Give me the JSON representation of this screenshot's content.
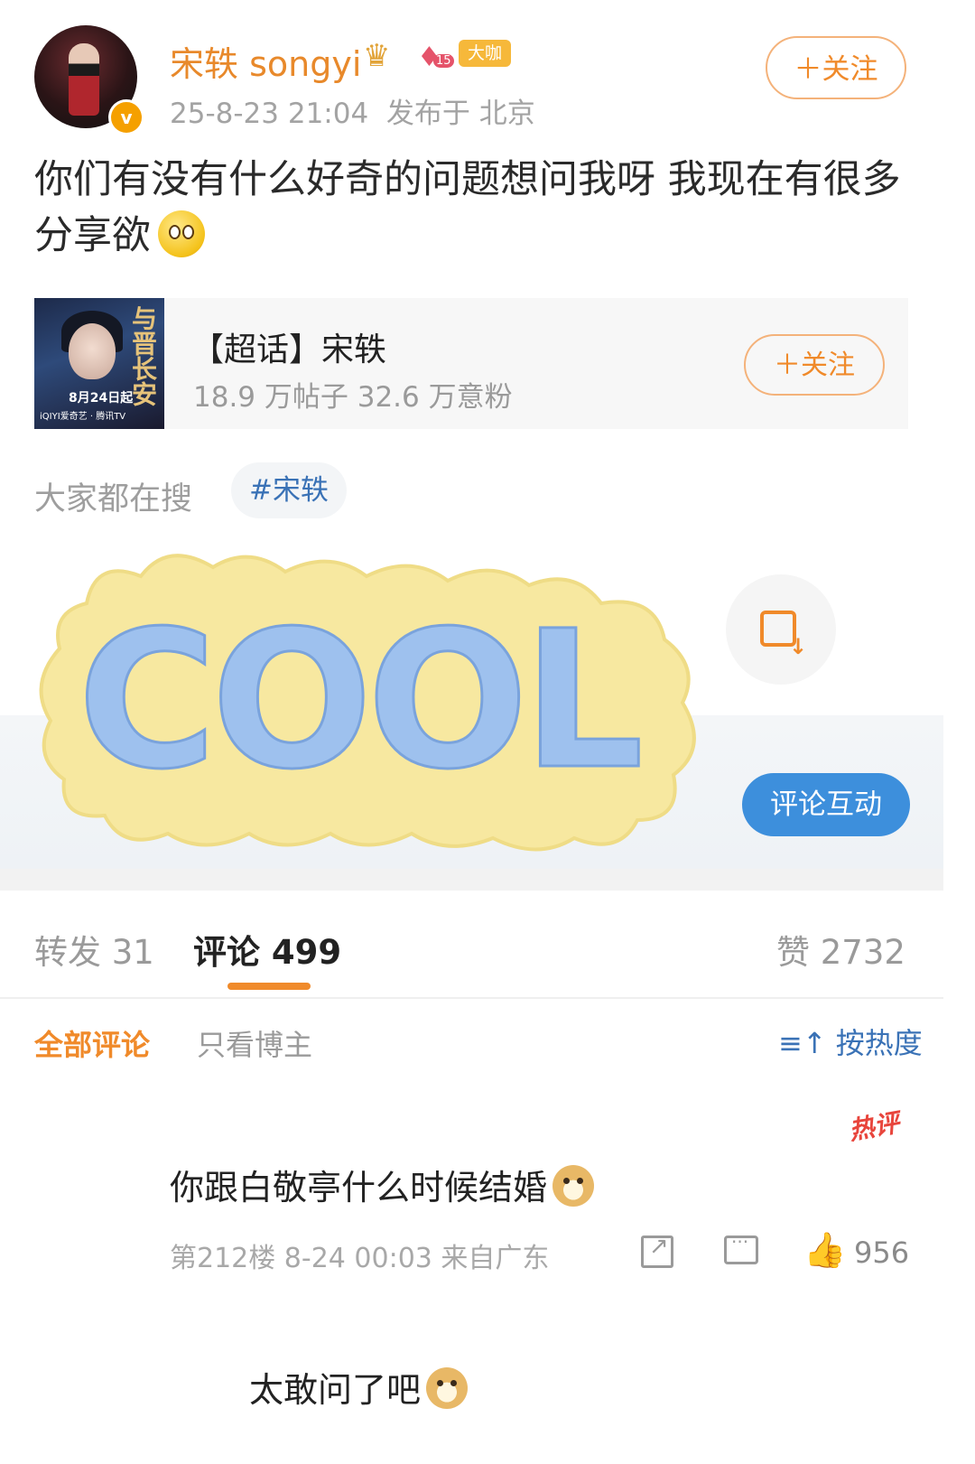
{
  "post": {
    "username": "宋轶 songyi",
    "badges": {
      "level": "15",
      "tag": "大咖"
    },
    "time": "25-8-23 21:04",
    "location": "发布于 北京",
    "follow_label": "＋关注",
    "text": "你们有没有什么好奇的问题想问我呀 我现在有很多分享欲",
    "emoji_icon": "thinking-emoji"
  },
  "topic_card": {
    "title": "【超话】宋轶",
    "stats": "18.9 万帖子 32.6 万意粉",
    "follow_label": "＋关注",
    "poster": {
      "title": "与晋长安",
      "date": "8月24日起",
      "brand": "iQIYI爱奇艺 · 腾讯TV"
    }
  },
  "search": {
    "label": "大家都在搜",
    "tag": "#宋轶"
  },
  "sticker": {
    "text": "COOL"
  },
  "interact_label": "评论互动",
  "tabs": {
    "repost": "转发 31",
    "comment": "评论 499",
    "like": "赞 2732"
  },
  "filters": {
    "all": "全部评论",
    "op_only": "只看博主",
    "sort": "按热度"
  },
  "comment": {
    "hot_label": "热评",
    "text": "你跟白敬亭什么时候结婚",
    "meta": "第212楼 8-24 00:03 来自广东",
    "likes": "956"
  },
  "reply": {
    "text": "太敢问了吧"
  }
}
